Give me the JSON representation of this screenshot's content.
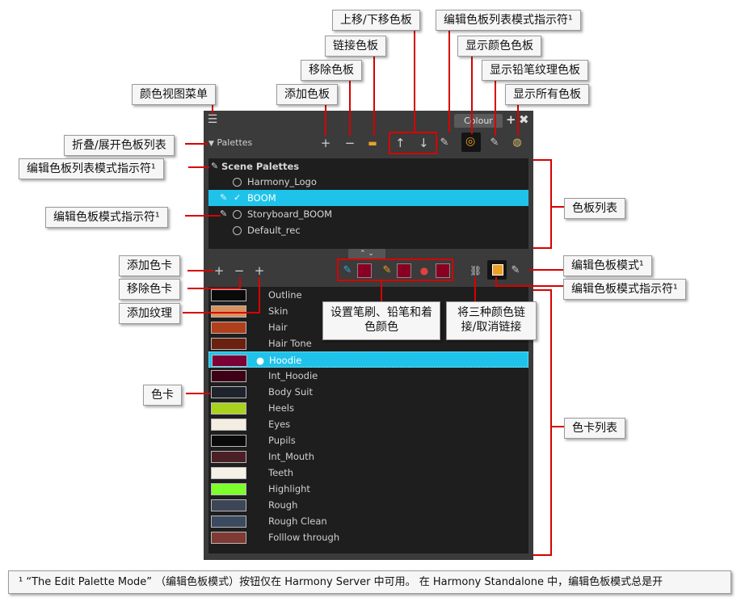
{
  "callouts": {
    "move_palette": "上移/下移色板",
    "edit_palette_list_mode_indicator_top": "编辑色板列表模式指示符¹",
    "link_palette": "链接色板",
    "show_colour_palettes": "显示颜色色板",
    "remove_palette": "移除色板",
    "show_pencil_texture_palettes": "显示铅笔纹理色板",
    "add_palette": "添加色板",
    "show_all_palettes": "显示所有色板",
    "colour_view_menu": "颜色视图菜单",
    "collapse_expand": "折叠/展开色板列表",
    "edit_palette_list_mode_indicator_left": "编辑色板列表模式指示符¹",
    "palette_list": "色板列表",
    "edit_palette_mode_indicator_left": "编辑色板模式指示符¹",
    "add_swatch": "添加色卡",
    "edit_palette_mode": "编辑色板模式¹",
    "remove_swatch": "移除色卡",
    "edit_palette_mode_indicator_right": "编辑色板模式指示符¹",
    "add_texture": "添加纹理",
    "set_brush_pencil_paint": "设置笔刷、铅笔和着色颜色",
    "link_three_colours": "将三种颜色链接/取消链接",
    "swatch": "色卡",
    "swatch_list": "色卡列表"
  },
  "panel": {
    "tab_label": "Colour",
    "palettes_label": "Palettes",
    "scene_palettes_label": "Scene Palettes",
    "palettes": [
      {
        "name": "Harmony_Logo",
        "selected": false
      },
      {
        "name": "BOOM",
        "selected": true
      },
      {
        "name": "Storyboard_BOOM",
        "selected": false
      },
      {
        "name": "Default_rec",
        "selected": false
      }
    ],
    "swatches": [
      {
        "name": "Outline",
        "color": "#0a0a0a",
        "selected": false
      },
      {
        "name": "Skin",
        "color": "#d9935e",
        "selected": false
      },
      {
        "name": "Hair",
        "color": "#b0401c",
        "selected": false
      },
      {
        "name": "Hair Tone",
        "color": "#6a2110",
        "selected": false
      },
      {
        "name": "Hoodie",
        "color": "#7a0035",
        "selected": true
      },
      {
        "name": "Int_Hoodie",
        "color": "#3d0017",
        "selected": false
      },
      {
        "name": "Body Suit",
        "color": "#1e232c",
        "selected": false
      },
      {
        "name": "Heels",
        "color": "#a9d21e",
        "selected": false
      },
      {
        "name": "Eyes",
        "color": "#f4ede2",
        "selected": false
      },
      {
        "name": "Pupils",
        "color": "#0a0a0a",
        "selected": false
      },
      {
        "name": "Int_Mouth",
        "color": "#4a2026",
        "selected": false
      },
      {
        "name": "Teeth",
        "color": "#f6f1e6",
        "selected": false
      },
      {
        "name": "Highlight",
        "color": "#7cff2a",
        "selected": false
      },
      {
        "name": "Rough",
        "color": "#3d4657",
        "selected": false
      },
      {
        "name": "Rough Clean",
        "color": "#3c4a5f",
        "selected": false
      },
      {
        "name": "Folllow through",
        "color": "#7e3a33",
        "selected": false
      }
    ]
  },
  "footnote": "¹ “The Edit Palette Mode” （编辑色板模式）按钮仅在 Harmony Server 中可用。 在 Harmony Standalone 中，编辑色板模式总是开"
}
